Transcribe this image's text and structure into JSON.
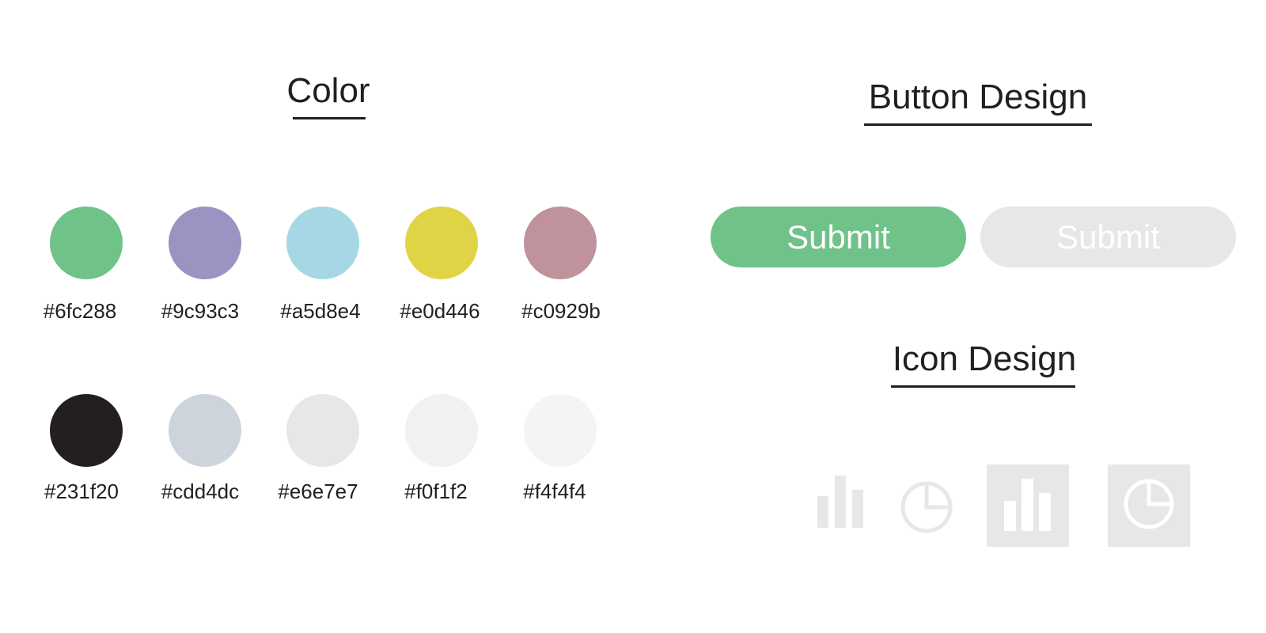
{
  "color_section": {
    "title": "Color",
    "swatches": [
      {
        "hex": "#6fc288",
        "label": "#6fc288"
      },
      {
        "hex": "#9c93c3",
        "label": "#9c93c3"
      },
      {
        "hex": "#a5d8e4",
        "label": "#a5d8e4"
      },
      {
        "hex": "#e0d446",
        "label": "#e0d446"
      },
      {
        "hex": "#c0929b",
        "label": "#c0929b"
      },
      {
        "hex": "#231f20",
        "label": "#231f20"
      },
      {
        "hex": "#cdd4dc",
        "label": "#cdd4dc"
      },
      {
        "hex": "#e6e7e7",
        "label": "#e6e7e7"
      },
      {
        "hex": "#f0f1f2",
        "label": "#f0f1f2"
      },
      {
        "hex": "#f4f4f4",
        "label": "#f4f4f4"
      }
    ]
  },
  "button_section": {
    "title": "Button Design",
    "primary_label": "Submit",
    "primary_color": "#6fc288",
    "disabled_label": "Submit",
    "disabled_color": "#e6e7e7"
  },
  "icon_section": {
    "title": "Icon Design",
    "icons": [
      "bar-chart-icon",
      "pie-chart-icon",
      "bar-chart-tile-icon",
      "pie-chart-tile-icon"
    ],
    "icon_color": "#e6e7e7",
    "tile_color": "#e6e7e7",
    "tile_icon_color": "#ffffff"
  }
}
